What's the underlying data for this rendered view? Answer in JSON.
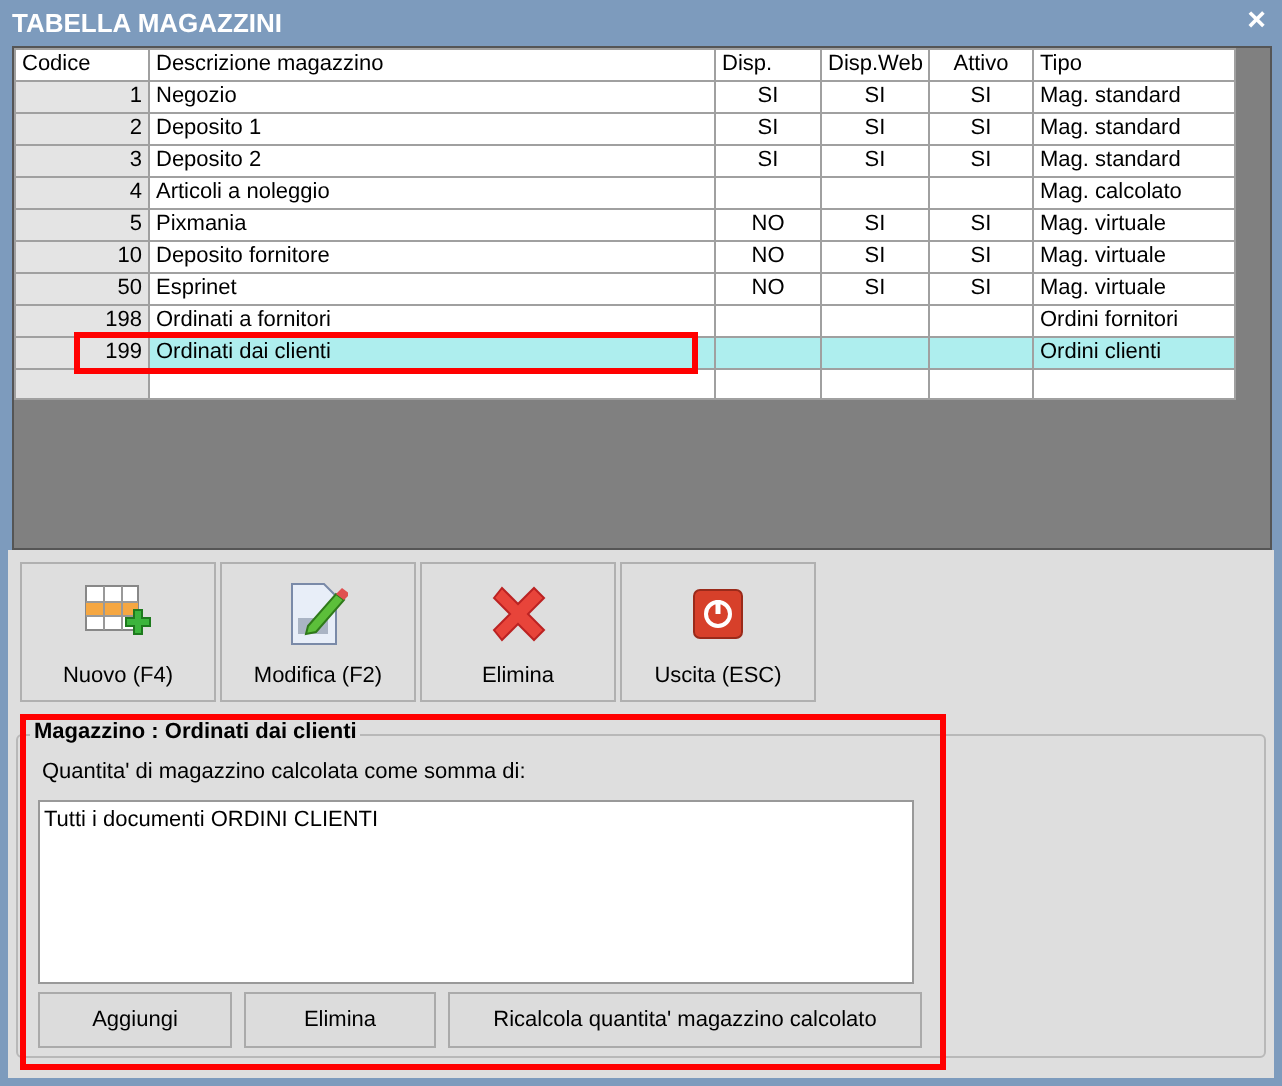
{
  "window": {
    "title": "TABELLA MAGAZZINI",
    "close": "×"
  },
  "table": {
    "columns": [
      "Codice",
      "Descrizione magazzino",
      "Disp.",
      "Disp.Web",
      "Attivo",
      "Tipo"
    ],
    "rows": [
      {
        "cells": [
          "1",
          "Negozio",
          "SI",
          "SI",
          "SI",
          "Mag. standard"
        ],
        "selected": false
      },
      {
        "cells": [
          "2",
          "Deposito 1",
          "SI",
          "SI",
          "SI",
          "Mag. standard"
        ],
        "selected": false
      },
      {
        "cells": [
          "3",
          "Deposito 2",
          "SI",
          "SI",
          "SI",
          "Mag. standard"
        ],
        "selected": false
      },
      {
        "cells": [
          "4",
          "Articoli a noleggio",
          "",
          "",
          "",
          "Mag. calcolato"
        ],
        "selected": false
      },
      {
        "cells": [
          "5",
          "Pixmania",
          "NO",
          "SI",
          "SI",
          "Mag. virtuale"
        ],
        "selected": false
      },
      {
        "cells": [
          "10",
          "Deposito fornitore",
          "NO",
          "SI",
          "SI",
          "Mag. virtuale"
        ],
        "selected": false
      },
      {
        "cells": [
          "50",
          "Esprinet",
          "NO",
          "SI",
          "SI",
          "Mag. virtuale"
        ],
        "selected": false
      },
      {
        "cells": [
          "198",
          "Ordinati a fornitori",
          "",
          "",
          "",
          "Ordini fornitori"
        ],
        "selected": false
      },
      {
        "cells": [
          "199",
          "Ordinati dai clienti",
          "",
          "",
          "",
          "Ordini clienti"
        ],
        "selected": true
      }
    ]
  },
  "toolbar": [
    {
      "kind": "new",
      "label": "Nuovo (F4)"
    },
    {
      "kind": "edit",
      "label": "Modifica (F2)"
    },
    {
      "kind": "delete",
      "label": "Elimina"
    },
    {
      "kind": "exit",
      "label": "Uscita (ESC)"
    }
  ],
  "detail": {
    "title": "Magazzino : Ordinati dai clienti",
    "caption": "Quantita' di magazzino calcolata come somma di:",
    "items": [
      "Tutti i documenti ORDINI CLIENTI"
    ],
    "buttons": [
      "Aggiungi",
      "Elimina",
      "Ricalcola quantita' magazzino calcolato"
    ]
  }
}
